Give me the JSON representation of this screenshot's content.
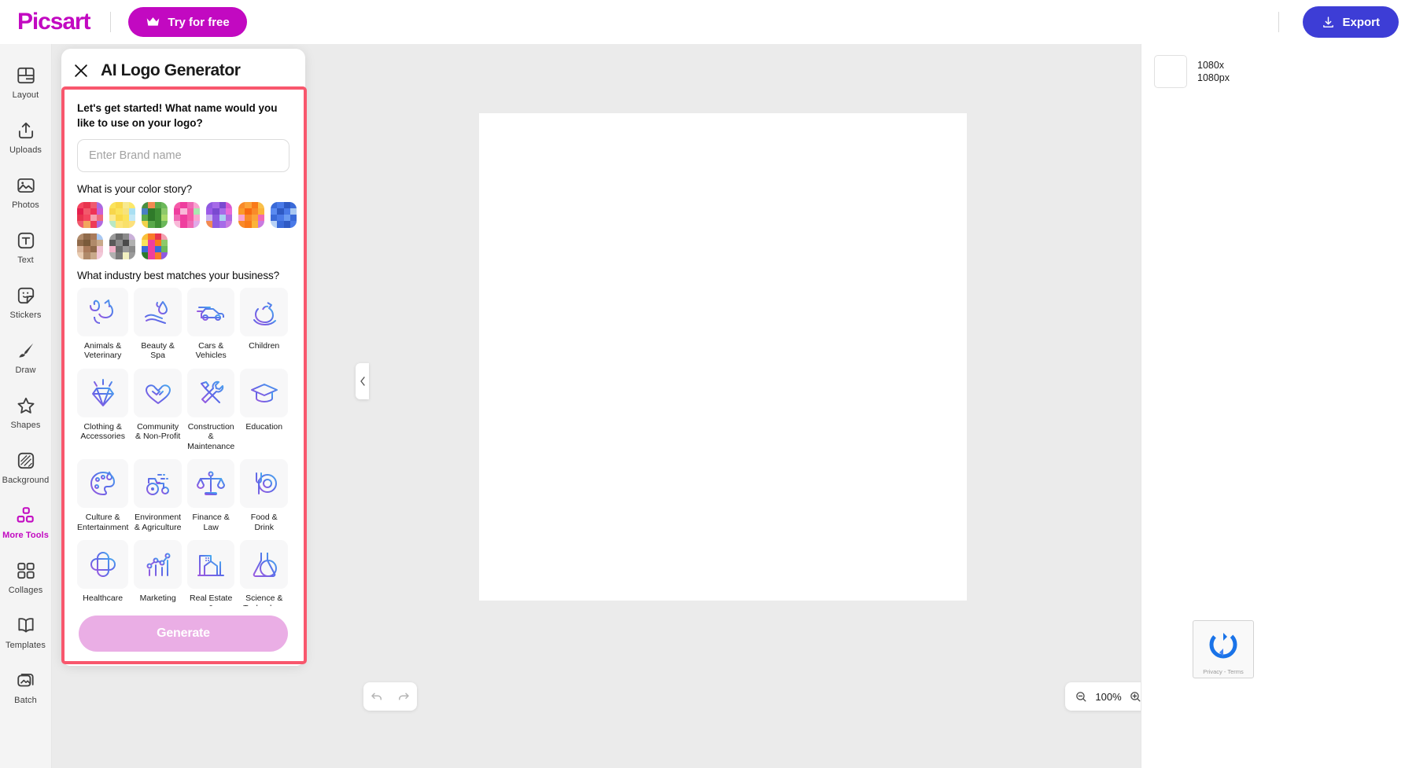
{
  "topbar": {
    "logo": "Picsart",
    "try_free_label": "Try for free",
    "export_label": "Export"
  },
  "rail": {
    "items": [
      {
        "label": "Layout",
        "icon": "layout-icon",
        "active": false
      },
      {
        "label": "Uploads",
        "icon": "upload-icon",
        "active": false
      },
      {
        "label": "Photos",
        "icon": "photos-icon",
        "active": false
      },
      {
        "label": "Text",
        "icon": "text-icon",
        "active": false
      },
      {
        "label": "Stickers",
        "icon": "stickers-icon",
        "active": false
      },
      {
        "label": "Draw",
        "icon": "draw-icon",
        "active": false
      },
      {
        "label": "Shapes",
        "icon": "shapes-icon",
        "active": false
      },
      {
        "label": "Background",
        "icon": "background-icon",
        "active": false
      },
      {
        "label": "More Tools",
        "icon": "more-tools-icon",
        "active": true
      },
      {
        "label": "Collages",
        "icon": "collages-icon",
        "active": false
      },
      {
        "label": "Templates",
        "icon": "templates-icon",
        "active": false
      },
      {
        "label": "Batch",
        "icon": "batch-icon",
        "active": false
      }
    ],
    "active_color": "#c209c1"
  },
  "panel": {
    "title": "AI Logo Generator",
    "close_icon": "close-icon",
    "question_name": "Let's get started! What name would you like to use on your logo?",
    "brand_input_placeholder": "Enter Brand name",
    "brand_input_value": "",
    "question_color": "What is your color story?",
    "question_industry": "What industry best matches your business?",
    "generate_label": "Generate",
    "generate_color": "#eaaee5",
    "highlight_color": "#f8576d"
  },
  "color_stories": [
    {
      "name": "red-palette",
      "colors": [
        "#f4455f",
        "#e8344e",
        "#f05a6e",
        "#a96ae0",
        "#e61e4d",
        "#f2596b",
        "#ef3355",
        "#c95fd6",
        "#e8344e",
        "#f4455f",
        "#f7a0ae",
        "#f06a7c",
        "#f05a6e",
        "#f2a65e",
        "#ee3b57",
        "#b06ae0"
      ]
    },
    {
      "name": "yellow-palette",
      "colors": [
        "#fbe35a",
        "#f9d84a",
        "#f7e98f",
        "#fce86a",
        "#f8d64b",
        "#fbe35a",
        "#f6e27d",
        "#a9dff2",
        "#fde98c",
        "#f9d84a",
        "#fbe35a",
        "#c3e8f6",
        "#b9e8c4",
        "#fde57a",
        "#f9e06a",
        "#fce07c"
      ]
    },
    {
      "name": "green-palette",
      "colors": [
        "#4a8f3e",
        "#f28a52",
        "#5aa94b",
        "#6cb85a",
        "#4a7fc4",
        "#2f7a2a",
        "#3f8f35",
        "#8dc96a",
        "#5aa94b",
        "#2f7a2a",
        "#3f8f35",
        "#a9d96a",
        "#f0d24a",
        "#5aa94b",
        "#3f8f35",
        "#6cb85a"
      ]
    },
    {
      "name": "pink-palette",
      "colors": [
        "#f55aa8",
        "#ef3e9e",
        "#f06ab5",
        "#f9a3cf",
        "#ef3e9e",
        "#f9b8d8",
        "#f55aa8",
        "#a9e8b0",
        "#f06ab5",
        "#ef3e9e",
        "#f55aa8",
        "#f9a3cf",
        "#f9b8d8",
        "#ef3e9e",
        "#f06ab5",
        "#e0a9e8"
      ]
    },
    {
      "name": "purple-palette",
      "colors": [
        "#8f5ae0",
        "#a66ae8",
        "#7a4ad0",
        "#d85ad0",
        "#9b5ae8",
        "#7a4ad0",
        "#a66ae8",
        "#e86ad8",
        "#c7b0f0",
        "#8f5ae0",
        "#a9d0f2",
        "#b06ae0",
        "#f28a52",
        "#8f5ae0",
        "#a66ae8",
        "#c97ae0"
      ]
    },
    {
      "name": "orange-palette",
      "colors": [
        "#f98a2a",
        "#fba43a",
        "#f97a1a",
        "#f9c04a",
        "#fb9a2a",
        "#f76a12",
        "#f98a2a",
        "#fbb43a",
        "#f9a3cf",
        "#f98a2a",
        "#fba43a",
        "#f06ab5",
        "#f98a2a",
        "#f97a1a",
        "#fbb43a",
        "#c97ae0"
      ]
    },
    {
      "name": "blue-palette",
      "colors": [
        "#3a6ad8",
        "#4a7ae8",
        "#2f5ac4",
        "#3a6ad8",
        "#5a8af0",
        "#2f5ac4",
        "#4a7ae8",
        "#a9c8f2",
        "#3a6ad8",
        "#4a7ae8",
        "#6a9af2",
        "#3a6ad8",
        "#b8d2f6",
        "#3a6ad8",
        "#2f5ac4",
        "#4a7ae8"
      ]
    },
    {
      "name": "brown-palette",
      "colors": [
        "#b08a6a",
        "#8f6a4a",
        "#a97a5a",
        "#a9c8f2",
        "#8f6a4a",
        "#7a5a3a",
        "#b08a6a",
        "#c9a98a",
        "#d8b49a",
        "#a97a5a",
        "#8f6a4a",
        "#f0c0d0",
        "#e8cbb0",
        "#b08a6a",
        "#c9a98a",
        "#f2c8d8"
      ]
    },
    {
      "name": "gray-palette",
      "colors": [
        "#9a9a9a",
        "#6a6a6a",
        "#8a8a8a",
        "#c9b0d8",
        "#5a5a5a",
        "#8a8a8a",
        "#4a4a4a",
        "#b0b0b0",
        "#f2b0c8",
        "#6a6a6a",
        "#9a9a9a",
        "#8a8a8a",
        "#b0b0b0",
        "#7a7a7a",
        "#f2f0c0",
        "#9a9a9a"
      ]
    },
    {
      "name": "multi-palette",
      "colors": [
        "#f9c03a",
        "#f97a2a",
        "#e8344e",
        "#f2a0b0",
        "#fbe35a",
        "#ef3e9e",
        "#f97a1a",
        "#8dc96a",
        "#3a6ad8",
        "#ef3e9e",
        "#3a6ad8",
        "#6cb85a",
        "#2f7a2a",
        "#ef3e9e",
        "#f97a2a",
        "#8f5ae0"
      ]
    }
  ],
  "industries": [
    {
      "label": "Animals & Veterinary",
      "icon": "dog-cat-icon"
    },
    {
      "label": "Beauty & Spa",
      "icon": "hand-droplet-icon"
    },
    {
      "label": "Cars & Vehicles",
      "icon": "car-icon"
    },
    {
      "label": "Children",
      "icon": "rocking-horse-icon"
    },
    {
      "label": "Clothing & Accessories",
      "icon": "diamond-icon"
    },
    {
      "label": "Community & Non-Profit",
      "icon": "heart-hands-icon"
    },
    {
      "label": "Construction & Maintenance",
      "icon": "hammer-wrench-icon"
    },
    {
      "label": "Education",
      "icon": "graduation-cap-icon"
    },
    {
      "label": "Culture & Entertainment",
      "icon": "palette-icon"
    },
    {
      "label": "Environment & Agriculture",
      "icon": "tractor-icon"
    },
    {
      "label": "Finance & Law",
      "icon": "scales-icon"
    },
    {
      "label": "Food & Drink",
      "icon": "fork-plate-icon"
    },
    {
      "label": "Healthcare",
      "icon": "medical-cross-icon"
    },
    {
      "label": "Marketing",
      "icon": "chart-dots-icon"
    },
    {
      "label": "Real Estate & Architecture",
      "icon": "building-icon"
    },
    {
      "label": "Science & Technology",
      "icon": "flask-icon"
    }
  ],
  "canvas": {
    "zoom_value": "100%",
    "zoom_out_icon": "zoom-out-icon",
    "zoom_in_icon": "zoom-in-icon",
    "settings_icon": "gear-icon",
    "undo_icon": "undo-icon",
    "redo_icon": "redo-icon",
    "collapse_left_icon": "chevron-left-icon",
    "collapse_right_icon": "chevron-right-icon"
  },
  "right_panel": {
    "layer_size_line1": "1080x",
    "layer_size_line2": "1080px"
  },
  "recaptcha": {
    "text": "Privacy - Terms"
  }
}
